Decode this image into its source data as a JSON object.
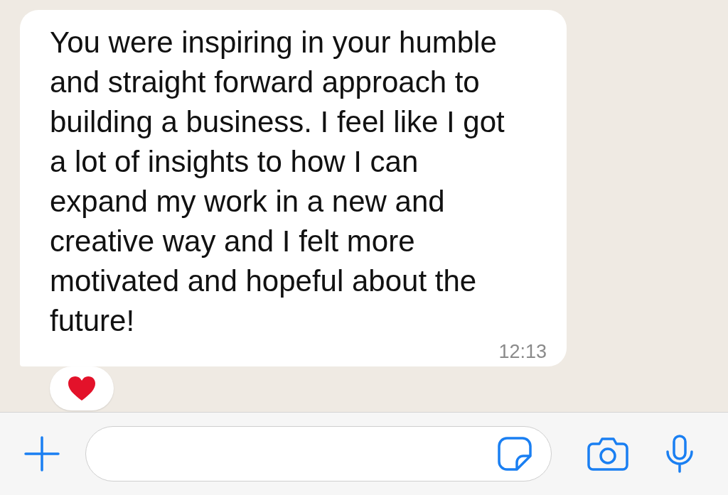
{
  "messages": [
    {
      "text": "You were inspiring in your humble and straight forward approach to building a business. I feel like I got a lot of insights to how I can expand my work in a new and creative way and I felt more motivated and hopeful about the future!",
      "time": "12:13",
      "reaction": true
    }
  ]
}
